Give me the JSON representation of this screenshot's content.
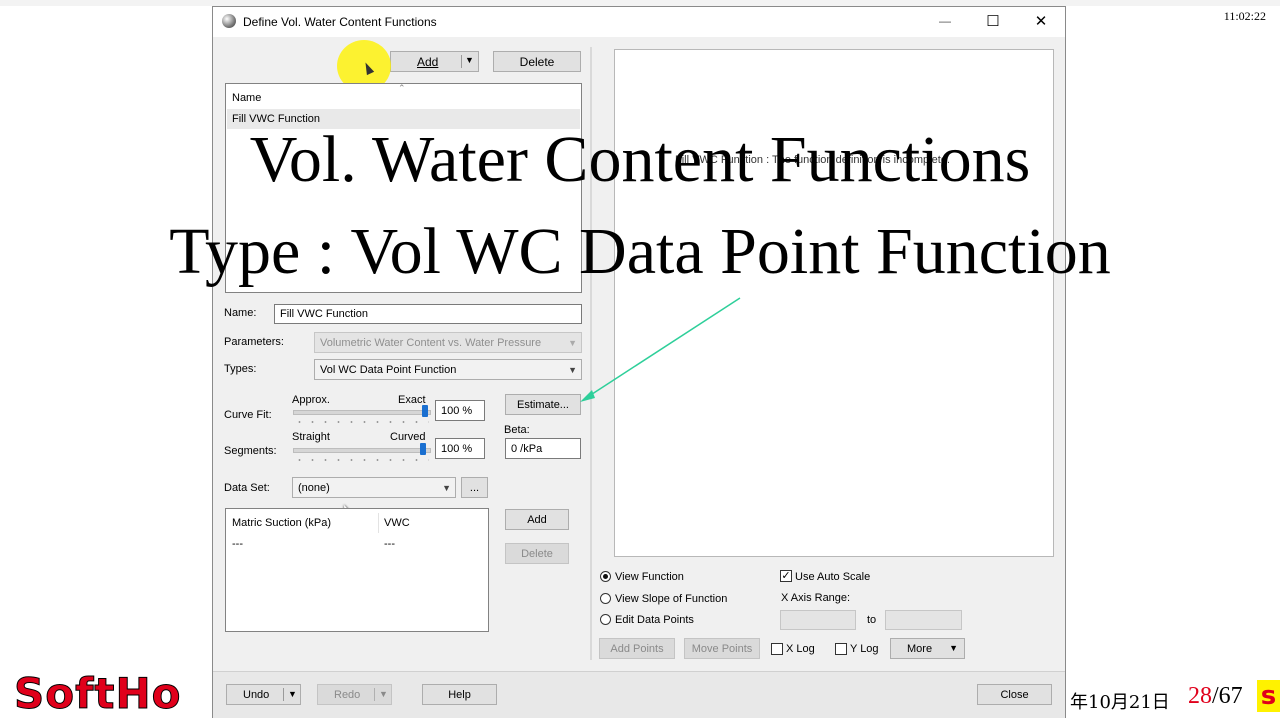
{
  "clock": "11:02:22",
  "window": {
    "title": "Define Vol. Water Content Functions",
    "minimize_glyph": "—",
    "maximize_glyph": "☐",
    "close_glyph": "✕"
  },
  "toolbar": {
    "add_label": "Add",
    "delete_label": "Delete"
  },
  "function_list": {
    "header": "Name",
    "items": [
      "Fill VWC Function"
    ]
  },
  "graph": {
    "message": "Fill VWC Function : The function definition is incomplete."
  },
  "form": {
    "name_label": "Name:",
    "name_value": "Fill VWC Function",
    "parameters_label": "Parameters:",
    "parameters_value": "Volumetric Water Content vs. Water Pressure",
    "types_label": "Types:",
    "types_value": "Vol WC Data Point Function",
    "curvefit_label": "Curve Fit:",
    "approx_label": "Approx.",
    "exact_label": "Exact",
    "curvefit_value": "100 %",
    "curvefit_level": 1.0,
    "estimate_label": "Estimate...",
    "segments_label": "Segments:",
    "straight_label": "Straight",
    "curved_label": "Curved",
    "segments_value": "100 %",
    "segments_level": 1.0,
    "beta_label": "Beta:",
    "beta_value": "0 /kPa",
    "dataset_label": "Data Set:",
    "dataset_value": "(none)",
    "dataset_more": "..."
  },
  "points_table": {
    "columns": [
      "Matric Suction (kPa)",
      "VWC"
    ],
    "rows": [
      [
        "---",
        "---"
      ]
    ],
    "add_label": "Add",
    "delete_label": "Delete"
  },
  "view_options": {
    "view_function": "View Function",
    "view_slope": "View Slope of Function",
    "edit_points": "Edit Data Points",
    "use_auto_scale": "Use Auto Scale",
    "x_axis_range": "X Axis Range:",
    "to_label": "to",
    "add_points": "Add Points",
    "move_points": "Move Points",
    "x_log": "X Log",
    "y_log": "Y Log",
    "more": "More"
  },
  "footer": {
    "undo": "Undo",
    "redo": "Redo",
    "help": "Help",
    "close": "Close"
  },
  "overlay": {
    "line1": "Vol. Water Content Functions",
    "line2": "Type : Vol WC Data Point Function"
  },
  "watermark": {
    "logo": "SoftHo",
    "date": "年10月21日",
    "page_current": "28",
    "page_total": "/67",
    "trailing": "s"
  },
  "colors": {
    "accent": "#1a6fd0",
    "arrow": "#2ecf9a",
    "highlight": "#fff200",
    "page_red": "#e0001b"
  }
}
